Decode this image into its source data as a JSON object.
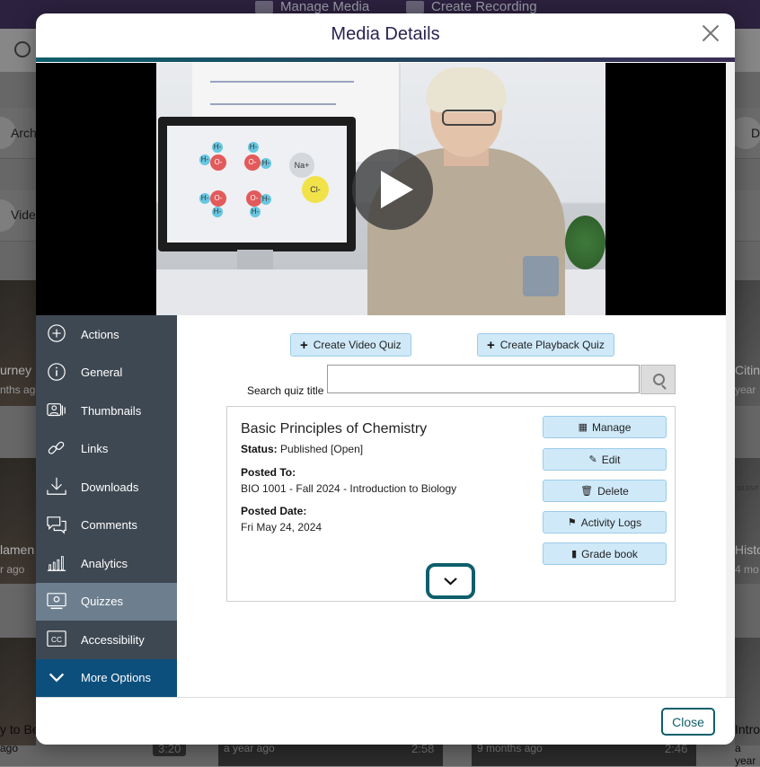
{
  "background": {
    "topbar_items": [
      "Manage Media",
      "Create Recording"
    ],
    "left_rows": [
      "Arch",
      "Vide"
    ],
    "right_rows": [
      "D"
    ],
    "left_cards": [
      {
        "title": "urney",
        "meta": "nths ago"
      },
      {
        "title": "lamen",
        "meta": "r ago"
      },
      {
        "title": "y to Be",
        "meta": "ago"
      }
    ],
    "right_cards": [
      {
        "title": "Citin",
        "meta": "year"
      },
      {
        "title": "Histo",
        "meta": "4 mo"
      },
      {
        "title": "Intro",
        "meta": "a year"
      }
    ],
    "bottom_cards": [
      {
        "meta": "a year ago",
        "duration": "2:58"
      },
      {
        "meta": "9 months ago",
        "duration": "2:46"
      }
    ],
    "left_duration": "3:20",
    "side_label": "SILENT"
  },
  "modal": {
    "title": "Media Details",
    "close_label": "Close"
  },
  "video": {
    "molecules": {
      "h": "H-",
      "o": "O-",
      "na": "Na+",
      "cl": "Cl-"
    }
  },
  "sidebar": {
    "items": [
      {
        "label": "Actions",
        "icon": "plus-circle-icon"
      },
      {
        "label": "General",
        "icon": "info-icon"
      },
      {
        "label": "Thumbnails",
        "icon": "thumbnails-icon"
      },
      {
        "label": "Links",
        "icon": "link-icon"
      },
      {
        "label": "Downloads",
        "icon": "download-icon"
      },
      {
        "label": "Comments",
        "icon": "comments-icon"
      },
      {
        "label": "Analytics",
        "icon": "analytics-icon"
      },
      {
        "label": "Quizzes",
        "icon": "quiz-icon"
      },
      {
        "label": "Accessibility",
        "icon": "cc-icon"
      },
      {
        "label": "More Options",
        "icon": "chevron-down-icon"
      }
    ],
    "active": "Quizzes"
  },
  "quizzes": {
    "create_video_quiz": "Create Video Quiz",
    "create_playback_quiz": "Create Playback Quiz",
    "search_label": "Search quiz title",
    "search_value": "",
    "card": {
      "title": "Basic Principles of Chemistry",
      "status_label": "Status:",
      "status_value": "Published [Open]",
      "posted_to_label": "Posted To:",
      "posted_to_value": "BIO 1001 - Fall 2024 - Introduction to Biology",
      "posted_date_label": "Posted Date:",
      "posted_date_value": "Fri May 24, 2024",
      "actions": [
        {
          "label": "Manage",
          "icon": "calendar-icon",
          "glyph": "▦"
        },
        {
          "label": "Edit",
          "icon": "edit-icon",
          "glyph": "✎"
        },
        {
          "label": "Delete",
          "icon": "trash-icon",
          "glyph": "🗑"
        },
        {
          "label": "Activity Logs",
          "icon": "flag-icon",
          "glyph": "⚑"
        },
        {
          "label": "Grade book",
          "icon": "book-icon",
          "glyph": "▮"
        }
      ]
    }
  },
  "colors": {
    "accent": "#0d5f6b",
    "sidebar_bg": "#3e4852",
    "sidebar_active": "#6d7f8f",
    "more_options_bg": "#0c4f7c",
    "button_bg": "#cfe9f9"
  }
}
